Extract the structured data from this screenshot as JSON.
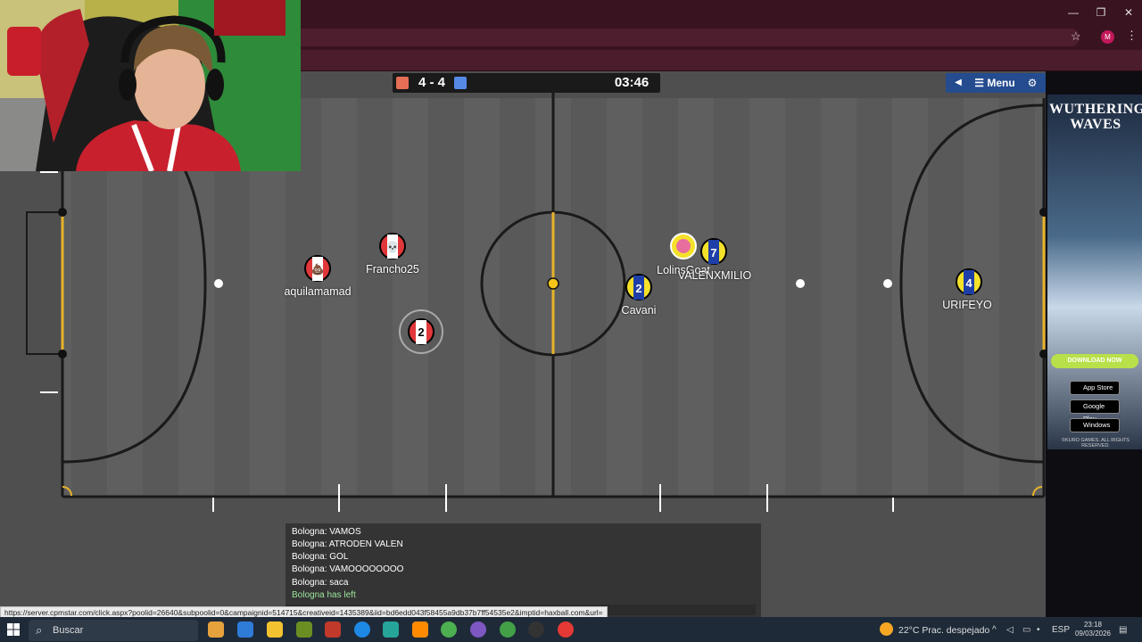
{
  "scoreboard": {
    "score": "4 - 4",
    "timer": "03:46",
    "red_color": "#e56e56",
    "blue_color": "#5689e5"
  },
  "menu": {
    "back_icon": "◀",
    "menu_label": "☰ Menu",
    "settings_icon": "⚙"
  },
  "players": {
    "red": [
      {
        "name": "aquilamamad",
        "avatar": "💩"
      },
      {
        "name": "Francho25",
        "avatar": "💀"
      },
      {
        "name": "",
        "avatar": "2"
      }
    ],
    "blue": [
      {
        "name": "LolinsGoat",
        "avatar": ""
      },
      {
        "name": "VALENXMILIO",
        "avatar": "7"
      },
      {
        "name": "Cavani",
        "avatar": "2"
      },
      {
        "name": "URIFEYO",
        "avatar": "4"
      }
    ]
  },
  "chat": {
    "lines": [
      "Bologna: VAMOS",
      "Bologna: ATRODEN VALEN",
      "Bologna: GOL",
      "Bologna: VAMOOOOOOOO",
      "Bologna: saca"
    ],
    "system": "Bologna has left"
  },
  "status_url": "https://server.cpmstar.com/click.aspx?poolid=26640&subpoolid=0&campaignid=514715&creativeid=1435389&iid=bd6edd043f58455a9db37b7ff54535e2&imptid=haxball.com&url=",
  "ad": {
    "title": "WUTHERING WAVES",
    "download": "DOWNLOAD NOW",
    "stores": [
      "App Store",
      "Google Play",
      "Windows"
    ],
    "footer": "©KURO GAMES. ALL RIGHTS RESERVED."
  },
  "taskbar": {
    "search_placeholder": "Buscar",
    "weather": "22°C  Prac. despejado",
    "lang": "ESP",
    "time": "23:18",
    "date": "09/03/2026"
  },
  "browser": {
    "profile_initial": "M"
  },
  "colors": {
    "field": "#5a5a5a",
    "line": "#1a1a1a",
    "goal_line": "#e8b32a",
    "red_team": "#e0383a",
    "blue_team": "#f5e12a"
  }
}
